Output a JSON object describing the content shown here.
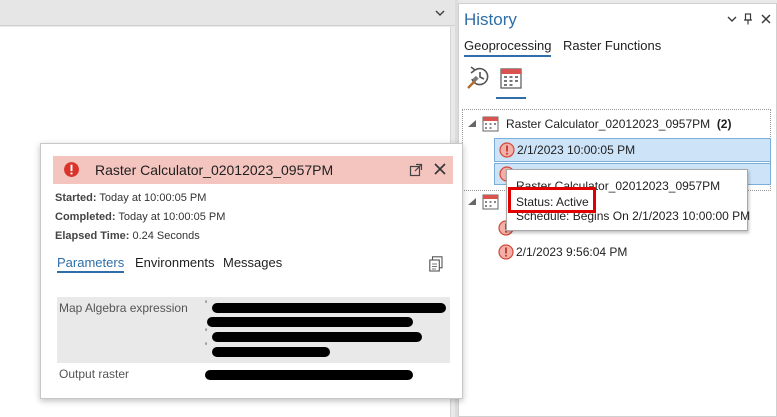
{
  "history": {
    "title": "History",
    "tabs": {
      "geoprocessing": "Geoprocessing",
      "raster_functions": "Raster Functions"
    },
    "group1": {
      "name": "Raster Calculator_02012023_0957PM",
      "count": "(2)"
    },
    "selected_item": {
      "time": "2/1/2023 10:00:05 PM"
    },
    "other_item": {
      "time": "2/1/2023 9:56:04 PM"
    }
  },
  "tooltip": {
    "name": "Raster Calculator_02012023_0957PM",
    "status": "Status: Active",
    "schedule": "Schedule: Begins On 2/1/2023 10:00:00 PM"
  },
  "card": {
    "title": "Raster Calculator_02012023_0957PM",
    "started_label": "Started:",
    "started_value": "Today at 10:00:05 PM",
    "completed_label": "Completed:",
    "completed_value": "Today at 10:00:05 PM",
    "elapsed_label": "Elapsed Time:",
    "elapsed_value": "0.24 Seconds",
    "tabs": {
      "parameters": "Parameters",
      "environments": "Environments",
      "messages": "Messages"
    },
    "params": [
      {
        "label": "Map Algebra expression"
      },
      {
        "label": "Output raster"
      }
    ]
  },
  "colors": {
    "accent": "#2f6ea8",
    "error_header_bg": "#f4c4bf",
    "selection_bg": "#cde3f7",
    "highlight_box": "#e00000"
  },
  "icons": {
    "history_tool": "history-tool-icon",
    "calendar": "calendar-icon",
    "error": "error-icon",
    "open_external": "open-external-icon",
    "close": "close-icon",
    "copy": "copy-icon"
  }
}
